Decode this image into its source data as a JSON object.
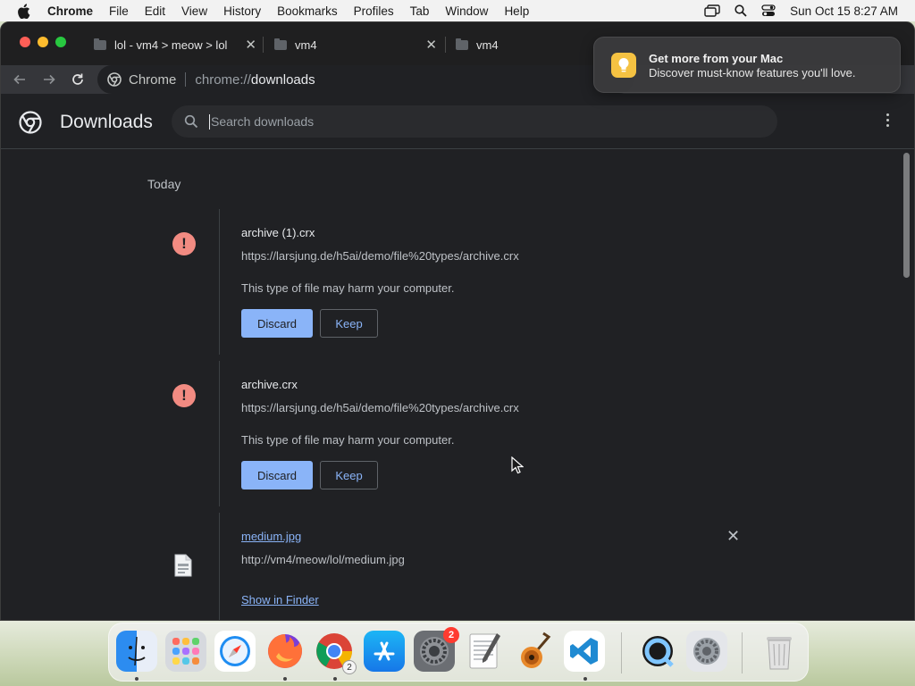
{
  "menubar": {
    "app": "Chrome",
    "items": [
      "File",
      "Edit",
      "View",
      "History",
      "Bookmarks",
      "Profiles",
      "Tab",
      "Window",
      "Help"
    ],
    "clock": "Sun Oct 15  8:27 AM"
  },
  "tabs": [
    {
      "title": "lol - vm4 > meow > lol",
      "close": "✕"
    },
    {
      "title": "vm4",
      "close": "✕"
    },
    {
      "title": "vm4"
    }
  ],
  "omnibox": {
    "site": "Chrome",
    "url_prefix": "chrome://",
    "url_main": "downloads"
  },
  "page": {
    "title": "Downloads",
    "search_placeholder": "Search downloads",
    "date_heading": "Today"
  },
  "downloads": [
    {
      "name": "archive (1).crx",
      "url": "https://larsjung.de/h5ai/demo/file%20types/archive.crx",
      "warning": "This type of file may harm your computer.",
      "discard": "Discard",
      "keep": "Keep",
      "icon": "warning-icon"
    },
    {
      "name": "archive.crx",
      "url": "https://larsjung.de/h5ai/demo/file%20types/archive.crx",
      "warning": "This type of file may harm your computer.",
      "discard": "Discard",
      "keep": "Keep",
      "icon": "warning-icon"
    },
    {
      "name": "medium.jpg",
      "url": "http://vm4/meow/lol/medium.jpg",
      "action": "Show in Finder",
      "remove": "✕",
      "icon": "image-file-icon"
    }
  ],
  "notification": {
    "title": "Get more from your Mac",
    "body": "Discover must-know features you'll love."
  },
  "dock": {
    "apps": [
      "Finder",
      "Launchpad",
      "Safari",
      "Firefox",
      "Chrome",
      "App Store",
      "System Preferences",
      "TextEdit",
      "GarageBand",
      "Visual Studio Code",
      "QuickTime Player",
      "System Preferences",
      "Trash"
    ],
    "badges": {
      "system_preferences": "2",
      "chrome": "2"
    }
  },
  "colors": {
    "accent": "#8ab4f8",
    "warning": "#f28b82",
    "page_bg": "#202124"
  }
}
